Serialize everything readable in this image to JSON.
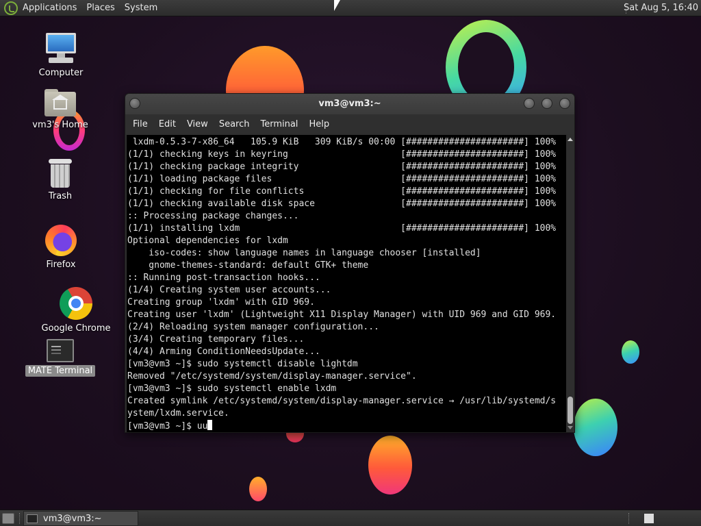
{
  "top_panel": {
    "menus": [
      "Applications",
      "Places",
      "System"
    ],
    "clock": "Sat Aug  5, 16:40"
  },
  "desktop_icons": [
    {
      "label": "Computer",
      "icon": "computer-icon"
    },
    {
      "label": "vm3's Home",
      "icon": "home-folder-icon"
    },
    {
      "label": "Trash",
      "icon": "trash-icon"
    },
    {
      "label": "Firefox",
      "icon": "firefox-icon"
    },
    {
      "label": "Google Chrome",
      "icon": "chrome-icon"
    },
    {
      "label": "MATE Terminal",
      "icon": "terminal-icon",
      "selected": true
    }
  ],
  "terminal": {
    "title": "vm3@vm3:~",
    "menu": [
      "File",
      "Edit",
      "View",
      "Search",
      "Terminal",
      "Help"
    ],
    "lines": [
      " lxdm-0.5.3-7-x86_64   105.9 KiB   309 KiB/s 00:00 [######################] 100%",
      "(1/1) checking keys in keyring                     [######################] 100%",
      "(1/1) checking package integrity                   [######################] 100%",
      "(1/1) loading package files                        [######################] 100%",
      "(1/1) checking for file conflicts                  [######################] 100%",
      "(1/1) checking available disk space                [######################] 100%",
      ":: Processing package changes...",
      "(1/1) installing lxdm                              [######################] 100%",
      "Optional dependencies for lxdm",
      "    iso-codes: show language names in language chooser [installed]",
      "    gnome-themes-standard: default GTK+ theme",
      ":: Running post-transaction hooks...",
      "(1/4) Creating system user accounts...",
      "Creating group 'lxdm' with GID 969.",
      "Creating user 'lxdm' (Lightweight X11 Display Manager) with UID 969 and GID 969.",
      "(2/4) Reloading system manager configuration...",
      "(3/4) Creating temporary files...",
      "(4/4) Arming ConditionNeedsUpdate...",
      "[vm3@vm3 ~]$ sudo systemctl disable lightdm",
      "Removed \"/etc/systemd/system/display-manager.service\".",
      "[vm3@vm3 ~]$ sudo systemctl enable lxdm",
      "Created symlink /etc/systemd/system/display-manager.service → /usr/lib/systemd/s",
      "ystem/lxdm.service."
    ],
    "prompt": "[vm3@vm3 ~]$ ",
    "input": "uu"
  },
  "taskbar": {
    "task_label": "vm3@vm3:~"
  }
}
